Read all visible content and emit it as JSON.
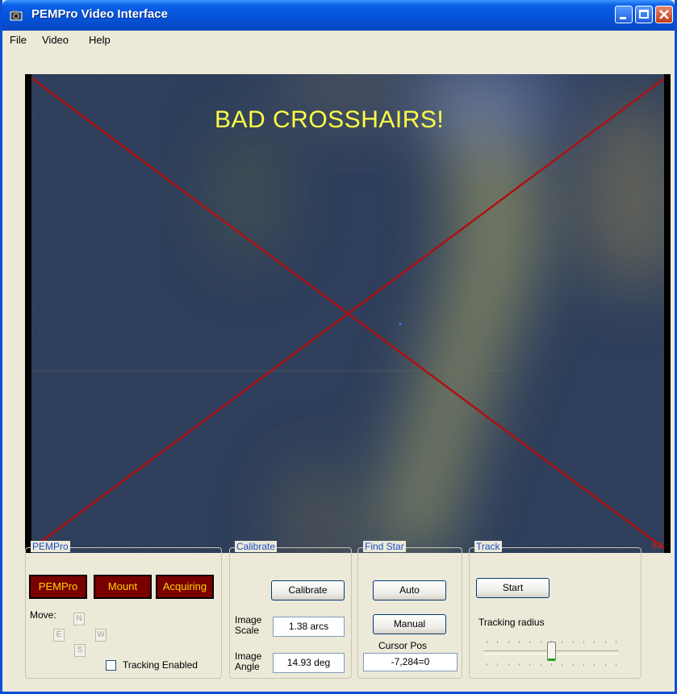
{
  "window": {
    "title": "PEMPro Video Interface"
  },
  "menu": [
    "File",
    "Video",
    "Help"
  ],
  "video": {
    "overlay_text": "BAD CROSSHAIRS!",
    "frame_counter": "83"
  },
  "pempro": {
    "title": "PEMPro",
    "buttons": [
      "PEMPro",
      "Mount",
      "Acquiring"
    ],
    "move_label": "Move:",
    "directions": {
      "n": "N",
      "e": "E",
      "w": "W",
      "s": "S"
    },
    "tracking_label": "Tracking Enabled",
    "tracking_checked": false
  },
  "calibrate": {
    "title": "Calibrate",
    "button": "Calibrate",
    "scale_label": "Image Scale",
    "scale_value": "1.38 arcs",
    "angle_label": "Image Angle",
    "angle_value": "14.93 deg"
  },
  "findstar": {
    "title": "Find Star",
    "auto": "Auto",
    "manual": "Manual",
    "cursor_label": "Cursor Pos",
    "cursor_value": "-7,284=0"
  },
  "track": {
    "title": "Track",
    "start": "Start",
    "radius_label": "Tracking radius",
    "radius_fraction": 0.5
  },
  "colors": {
    "titlebar": "#0552d8",
    "button_red": "#7a0000",
    "button_text": "#ffd200",
    "crosshair": "#b01010",
    "overlay_text": "#ffff44",
    "group_title": "#1a4fc8"
  }
}
